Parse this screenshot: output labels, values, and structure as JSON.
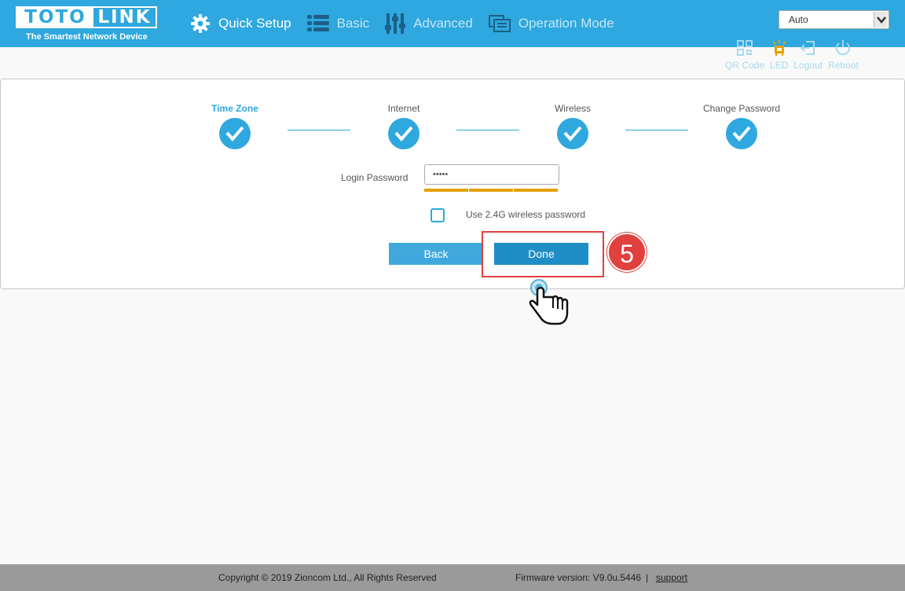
{
  "brand": {
    "logo_left": "TOTO",
    "logo_right": "LINK",
    "tagline": "The Smartest Network Device"
  },
  "nav": {
    "items": [
      {
        "label": "Quick Setup",
        "icon": "gear-icon",
        "active": true
      },
      {
        "label": "Basic",
        "icon": "list-icon",
        "active": false
      },
      {
        "label": "Advanced",
        "icon": "sliders-icon",
        "active": false
      },
      {
        "label": "Operation Mode",
        "icon": "operation-mode-icon",
        "active": false
      }
    ]
  },
  "language_select": {
    "value": "Auto"
  },
  "tools": [
    {
      "label": "QR Code",
      "icon": "qr-code-icon"
    },
    {
      "label": "LED",
      "icon": "led-icon"
    },
    {
      "label": "Logout",
      "icon": "logout-icon"
    },
    {
      "label": "Reboot",
      "icon": "power-icon"
    }
  ],
  "steps": [
    {
      "label": "Time Zone",
      "active": true,
      "done": true
    },
    {
      "label": "Internet",
      "active": false,
      "done": true
    },
    {
      "label": "Wireless",
      "active": false,
      "done": true
    },
    {
      "label": "Change Password",
      "active": false,
      "done": true
    }
  ],
  "form": {
    "password_label": "Login Password",
    "password_value": "•••••",
    "use_wireless_label": "Use 2.4G wireless password",
    "use_wireless_checked": false,
    "back_label": "Back",
    "done_label": "Done"
  },
  "annotation": {
    "step_number": "5"
  },
  "footer": {
    "copyright": "Copyright © 2019 Zioncom Ltd., All Rights Reserved",
    "firmware": "Firmware version: V9.0u.5446",
    "separator": "|",
    "support": "support"
  },
  "colors": {
    "header": "#2ea8de",
    "accent": "#2ea8de",
    "done_button": "#1f8dc5",
    "strength_bar": "#e5a000",
    "highlight": "#e0403e",
    "footer": "#9a9a9a"
  }
}
